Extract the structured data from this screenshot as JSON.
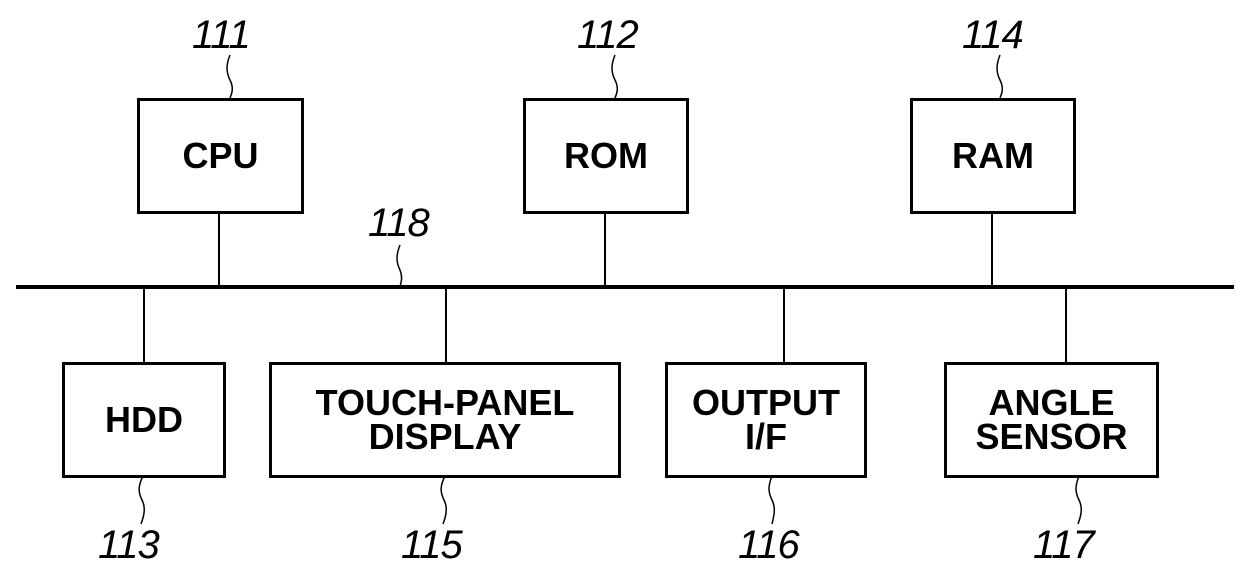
{
  "diagram": {
    "type": "block-diagram",
    "bus": {
      "ref": "118"
    },
    "top_blocks": [
      {
        "id": "cpu",
        "label": "CPU",
        "ref": "111"
      },
      {
        "id": "rom",
        "label": "ROM",
        "ref": "112"
      },
      {
        "id": "ram",
        "label": "RAM",
        "ref": "114"
      }
    ],
    "bottom_blocks": [
      {
        "id": "hdd",
        "label": "HDD",
        "ref": "113"
      },
      {
        "id": "touch-panel-display",
        "label": "TOUCH-PANEL\nDISPLAY",
        "ref": "115"
      },
      {
        "id": "output-if",
        "label": "OUTPUT\nI/F",
        "ref": "116"
      },
      {
        "id": "angle-sensor",
        "label": "ANGLE\nSENSOR",
        "ref": "117"
      }
    ]
  }
}
